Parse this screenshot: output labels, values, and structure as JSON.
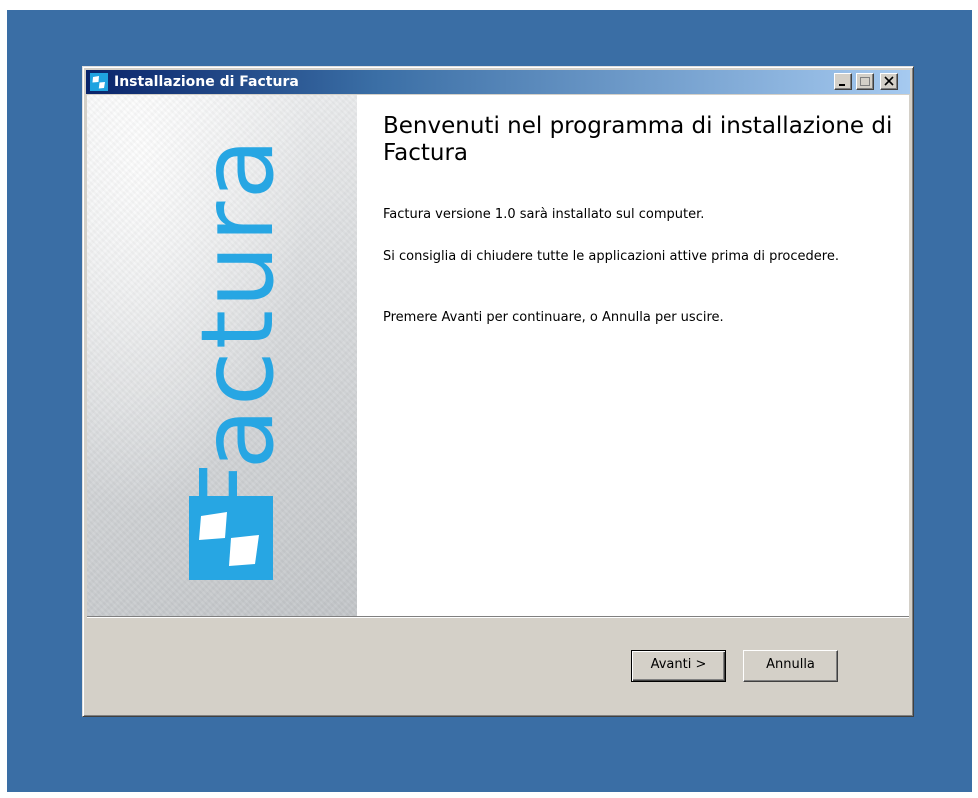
{
  "window": {
    "title": "Installazione di Factura",
    "controls": {
      "minimize_icon": "minimize-icon",
      "maximize_icon": "maximize-icon",
      "close_icon": "close-icon"
    }
  },
  "sidebar": {
    "brand_text": "Factura",
    "logo_icon": "factura-logo-icon",
    "accent_color": "#27a6e3"
  },
  "main": {
    "title": "Benvenuti nel programma di installazione di Factura",
    "paragraphs": [
      "Factura versione 1.0 sarà installato sul computer.",
      "Si consiglia di chiudere tutte le applicazioni attive prima di procedere.",
      "Premere Avanti per continuare, o Annulla per uscire."
    ]
  },
  "buttons": {
    "next_label": "Avanti >",
    "cancel_label": "Annulla"
  },
  "colors": {
    "desktop": "#3a6ea5",
    "titlebar_start": "#0a246a",
    "titlebar_end": "#a6caf0",
    "dialog_face": "#d4d0c8"
  }
}
